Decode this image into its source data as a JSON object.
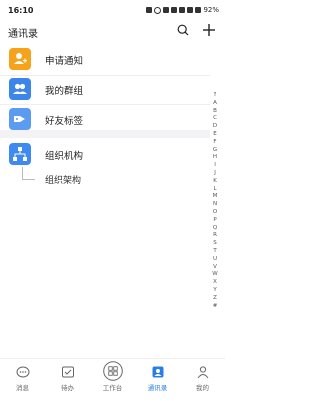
{
  "status_bar": {
    "time": "16:10",
    "battery": "92%"
  },
  "header": {
    "title": "通讯录"
  },
  "menu": [
    {
      "label": "申请通知"
    },
    {
      "label": "我的群组"
    },
    {
      "label": "好友标签"
    }
  ],
  "org": {
    "label": "组织机构",
    "sub_item": "组织架构"
  },
  "index_letters": [
    "↑",
    "A",
    "B",
    "C",
    "D",
    "E",
    "F",
    "G",
    "H",
    "I",
    "J",
    "K",
    "L",
    "M",
    "N",
    "O",
    "P",
    "Q",
    "R",
    "S",
    "T",
    "U",
    "V",
    "W",
    "X",
    "Y",
    "Z",
    "#"
  ],
  "tabs": [
    {
      "label": "消息",
      "icon": "message-icon"
    },
    {
      "label": "待办",
      "icon": "todo-icon"
    },
    {
      "label": "工作台",
      "icon": "workbench-icon"
    },
    {
      "label": "通讯录",
      "icon": "contacts-icon",
      "active": true
    },
    {
      "label": "我的",
      "icon": "profile-icon"
    }
  ],
  "colors": {
    "accent": "#2a7de8",
    "notify_icon": "#f5a31a",
    "group_icon": "#3b86e8",
    "tag_icon": "#5b9cf0",
    "org_icon": "#3f8af0"
  }
}
